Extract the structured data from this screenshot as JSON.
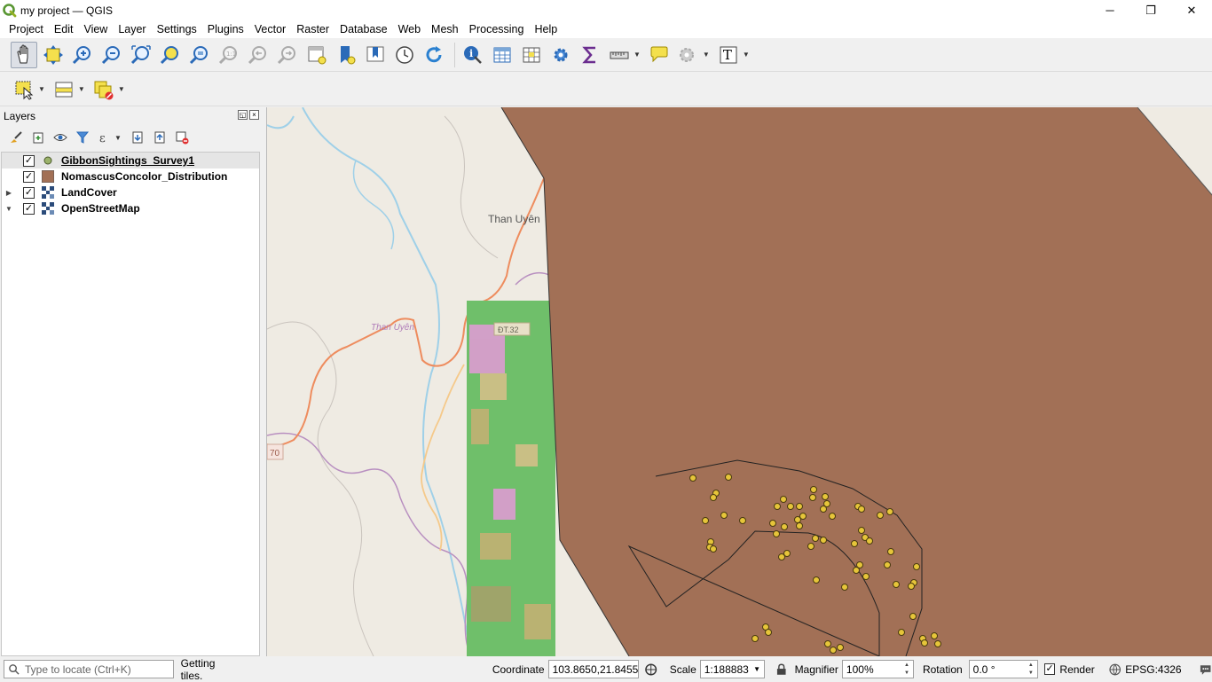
{
  "window": {
    "title": "my project — QGIS",
    "minimize": "─",
    "restore": "❐",
    "close": "✕"
  },
  "menu": [
    "Project",
    "Edit",
    "View",
    "Layer",
    "Settings",
    "Plugins",
    "Vector",
    "Raster",
    "Database",
    "Web",
    "Mesh",
    "Processing",
    "Help"
  ],
  "toolbar1": {
    "icons": [
      "pan-map-icon",
      "pan-to-selection-icon",
      "zoom-in-icon",
      "zoom-out-icon",
      "zoom-full-icon",
      "zoom-to-selection-icon",
      "zoom-to-layer-icon",
      "zoom-native-icon",
      "zoom-last-icon",
      "zoom-next-icon",
      "new-map-view-icon",
      "new-bookmark-icon",
      "show-bookmarks-icon",
      "temporal-controller-icon",
      "refresh-icon",
      "identify-icon",
      "open-attribute-table-icon",
      "field-calculator-icon",
      "toolbox-icon",
      "statistical-summary-icon",
      "measure-icon",
      "map-tips-icon",
      "annotation-icon",
      "text-annotation-icon"
    ],
    "text_annotation_glyph": "T"
  },
  "toolbar2": {
    "icons": [
      "select-features-icon",
      "attribute-table-select-icon",
      "deselect-icon"
    ]
  },
  "layers_panel": {
    "title": "Layers",
    "float_btn": "◱",
    "close_btn": "×",
    "layers": [
      {
        "name": "GibbonSightings_Survey1",
        "checked": "✓",
        "icon": "point-layer-icon",
        "expander": "",
        "selected": true
      },
      {
        "name": "NomascusConcolor_Distribution",
        "checked": "✓",
        "icon": "polygon-layer-icon",
        "expander": "",
        "selected": false
      },
      {
        "name": "LandCover",
        "checked": "✓",
        "icon": "raster-layer-icon",
        "expander": "▶",
        "selected": false
      },
      {
        "name": "OpenStreetMap",
        "checked": "✓",
        "icon": "raster-layer-icon",
        "expander": "▼",
        "selected": false
      }
    ]
  },
  "map": {
    "labels": {
      "town": "Than Uyên",
      "district": "Than Uyên",
      "road": "ĐT.32",
      "road_shield": "70"
    },
    "colors": {
      "background": "#efebe3",
      "polygon": "#a27056",
      "landcover_green": "#6fbf6a",
      "points": "#e6c53a"
    }
  },
  "statusbar": {
    "locator_placeholder": "Type to locate (Ctrl+K)",
    "message": "Getting tiles.",
    "coordinate_label": "Coordinate",
    "coordinate_value": "103.8650,21.8455",
    "scale_label": "Scale",
    "scale_value": "1:188883",
    "magnifier_label": "Magnifier",
    "magnifier_value": "100%",
    "rotation_label": "Rotation",
    "rotation_value": "0.0 °",
    "render_label": "Render",
    "render_checked": "✓",
    "crs": "EPSG:4326"
  }
}
